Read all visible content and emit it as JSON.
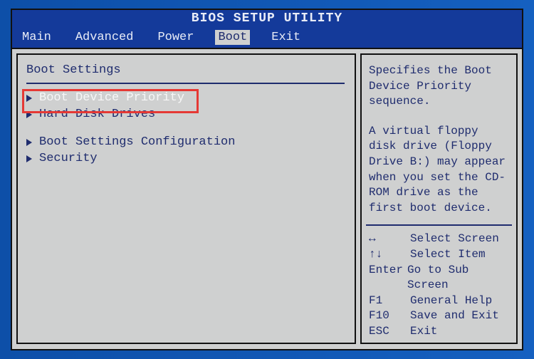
{
  "title": "BIOS SETUP UTILITY",
  "menu": {
    "items": [
      "Main",
      "Advanced",
      "Power",
      "Boot",
      "Exit"
    ],
    "selected_index": 3
  },
  "left": {
    "section_title": "Boot Settings",
    "group1": [
      "Boot Device Priority",
      "Hard Disk Drives"
    ],
    "group2": [
      "Boot Settings Configuration",
      "Security"
    ],
    "selected_index": 0
  },
  "help": {
    "para1": "Specifies the Boot Device Priority sequence.",
    "para2": "A virtual floppy disk drive (Floppy Drive B:) may appear when you set the CD-ROM drive as the first boot device."
  },
  "keys": [
    {
      "key": "↔",
      "action": "Select Screen"
    },
    {
      "key": "↑↓",
      "action": "Select Item"
    },
    {
      "key": "Enter",
      "action": "Go to Sub Screen"
    },
    {
      "key": "F1",
      "action": "General Help"
    },
    {
      "key": "F10",
      "action": "Save and Exit"
    },
    {
      "key": "ESC",
      "action": "Exit"
    }
  ]
}
